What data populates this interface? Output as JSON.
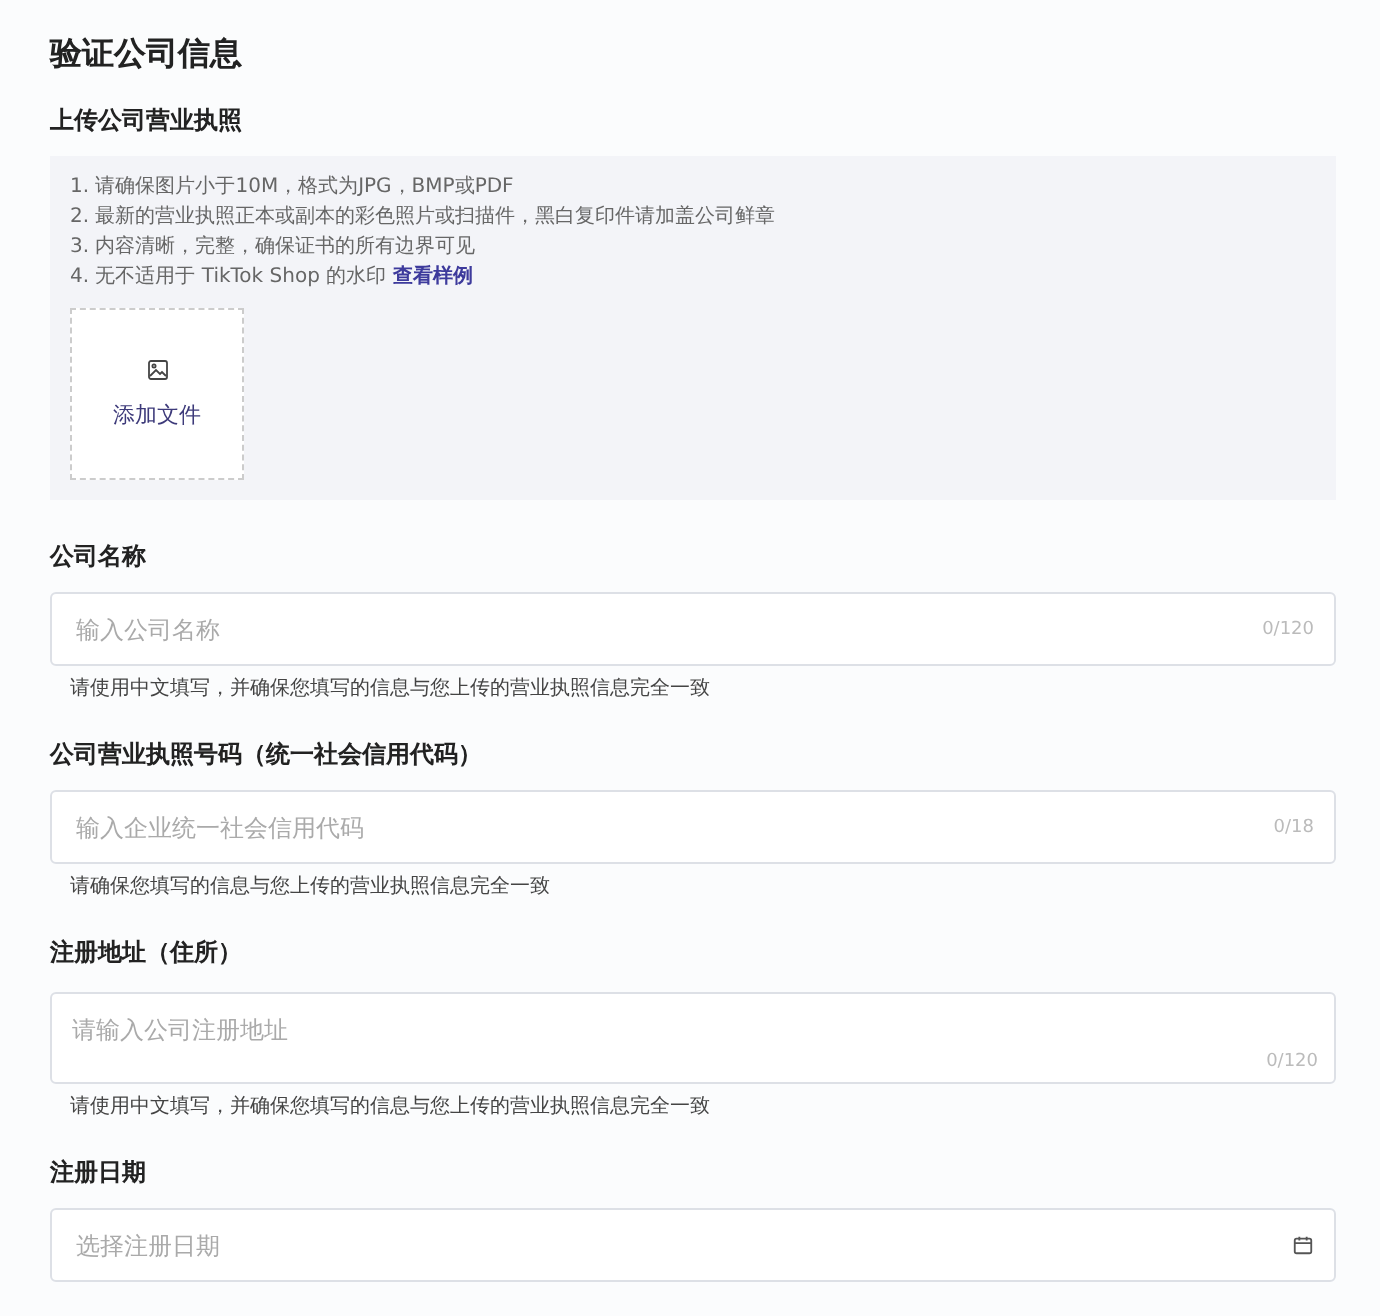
{
  "title": "验证公司信息",
  "upload": {
    "label": "上传公司营业执照",
    "rules": [
      {
        "text": "1. 请确保图片小于10M，格式为JPG，BMP或PDF"
      },
      {
        "text": "2. 最新的营业执照正本或副本的彩色照片或扫描件，黑白复印件请加盖公司鲜章"
      },
      {
        "text": "3. 内容清晰，完整，确保证书的所有边界可见"
      },
      {
        "text": "4. 无不适用于 TikTok Shop 的水印",
        "link": "查看样例"
      }
    ],
    "button": "添加文件"
  },
  "fields": [
    {
      "kind": "text",
      "label": "公司名称",
      "placeholder": "输入公司名称",
      "counter": "0/120",
      "hint": "请使用中文填写，并确保您填写的信息与您上传的营业执照信息完全一致"
    },
    {
      "kind": "text",
      "label": "公司营业执照号码（统一社会信用代码）",
      "placeholder": "输入企业统一社会信用代码",
      "counter": "0/18",
      "hint": "请确保您填写的信息与您上传的营业执照信息完全一致"
    },
    {
      "kind": "textarea",
      "label": "注册地址（住所）",
      "placeholder": "请输入公司注册地址",
      "counter": "0/120",
      "hint": "请使用中文填写，并确保您填写的信息与您上传的营业执照信息完全一致"
    },
    {
      "kind": "date",
      "label": "注册日期",
      "placeholder": "选择注册日期"
    }
  ]
}
